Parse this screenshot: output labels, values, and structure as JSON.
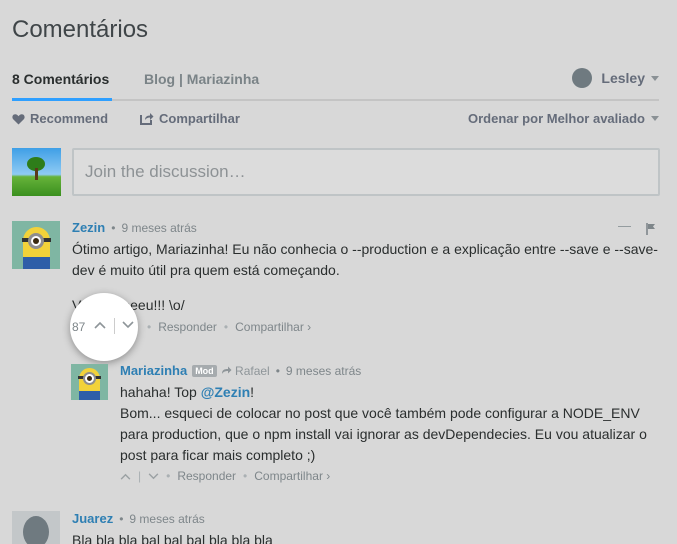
{
  "title": "Comentários",
  "tabs": {
    "comments": "8 Comentários",
    "blog": "Blog | Mariazinha"
  },
  "user": {
    "name": "Lesley"
  },
  "actions": {
    "recommend": "Recommend",
    "share": "Compartilhar",
    "sort": "Ordenar por Melhor avaliado"
  },
  "input": {
    "placeholder": "Join the discussion…"
  },
  "comments": [
    {
      "author": "Zezin",
      "time": "9 meses atrás",
      "paragraphs": [
        "Ótimo artigo, Mariazinha! Eu não conhecia o --production e a explicação entre --save e --save-dev é muito útil pra quem está começando.",
        "Valeeeeeeeu!!! \\o/"
      ],
      "votes": "87",
      "reply": "Responder",
      "share": "Compartilhar ›",
      "replies": [
        {
          "author": "Mariazinha",
          "badge": "Mod",
          "reply_to": "Rafael",
          "time": "9 meses atrás",
          "line1_prefix": "hahaha! Top ",
          "mention": "@Zezin",
          "line1_suffix": "!",
          "text": "Bom... esqueci de colocar no post que você também pode configurar a NODE_ENV para production, que o npm install vai ignorar as devDependecies. Eu vou atualizar o post para ficar mais completo ;)",
          "reply": "Responder",
          "share": "Compartilhar ›"
        }
      ]
    },
    {
      "author": "Juarez",
      "time": "9 meses atrás",
      "text": "Bla bla bla bal bal bal bla bla bla"
    }
  ]
}
